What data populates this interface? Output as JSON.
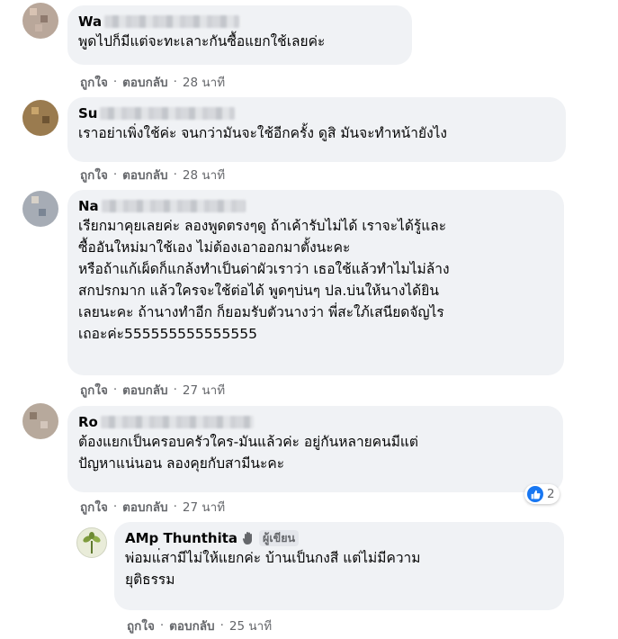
{
  "comments": [
    {
      "name_visible": "Wa",
      "text": "พูดไปก็มีแต่จะทะเลาะกันซื้อแยกใช้เลยค่ะ",
      "time": "28 นาที"
    },
    {
      "name_visible": "Su",
      "text": "เราอย่าเพิ่งใช้ค่ะ จนกว่ามันจะใช้อีกครั้ง ดูสิ มันจะทำหน้ายังไง",
      "time": "28 นาที"
    },
    {
      "name_visible": "Na",
      "text": "เรียกมาคุยเลยค่ะ ลองพูดตรงๆดู ถ้าเค้ารับไม่ได้ เราจะได้รู้และ\nซื้ออันใหม่มาใช้เอง ไม่ต้องเอาออกมาตั้งนะคะ\nหรือถ้าแก้เผ็ดก็แกล้งทำเป็นด่าผัวเราว่า เธอใช้แล้วทำไมไม่ล้าง\nสกปรกมาก แล้วใครจะใช้ต่อได้ พูดๆบ่นๆ ปล.บ่นให้นางได้ยิน\nเลยนะคะ ถ้านางทำอีก ก็ยอมรับตัวนางว่า พี่สะใภ้เสนียดจัญไร\nเถอะค่ะ555555555555555",
      "time": "27 นาที"
    },
    {
      "name_visible": "Ro",
      "text": "ต้องแยกเป็นครอบครัวใคร-มันแล้วค่ะ อยู่กันหลายคนมีแต่\nปัญหาแน่นอน ลองคุยกับสามีนะคะ",
      "time": "27 นาที",
      "reaction_count": "2"
    }
  ],
  "reply": {
    "name": "AMp Thunthita",
    "badge": "ผู้เขียน",
    "text": "พ่อมแ่สามีไม่ให้แยกค่ะ บ้านเป็นกงสี แต่ไม่มีความ\nยุติธรรม",
    "time": "25 นาที"
  },
  "actions": {
    "like": "ถูกใจ",
    "reply": "ตอบกลับ",
    "separator": "·"
  },
  "colors": {
    "bubble": "#f0f2f5",
    "meta": "#65676b",
    "like_blue": "#1877f2"
  }
}
